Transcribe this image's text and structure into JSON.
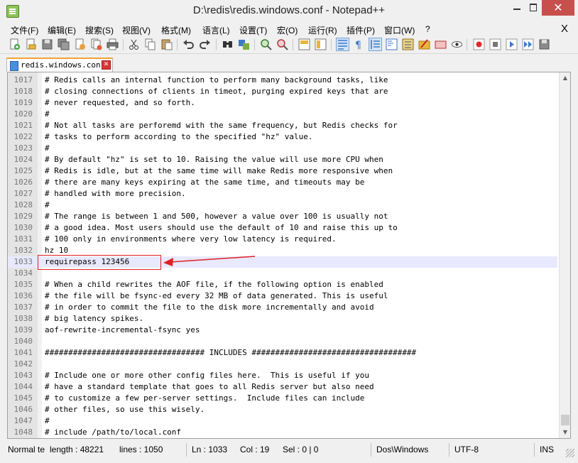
{
  "window": {
    "title": "D:\\redis\\redis.windows.conf - Notepad++",
    "close_label": "✕"
  },
  "menu": {
    "items": [
      "文件(F)",
      "编辑(E)",
      "搜索(S)",
      "视图(V)",
      "格式(M)",
      "语言(L)",
      "设置(T)",
      "宏(O)",
      "运行(R)",
      "插件(P)",
      "窗口(W)",
      "?"
    ],
    "close": "X"
  },
  "toolbar": {
    "icons": [
      "new-file-icon",
      "open-file-icon",
      "save-icon",
      "save-all-icon",
      "close-icon",
      "close-all-icon",
      "print-icon",
      "cut-icon",
      "copy-icon",
      "paste-icon",
      "undo-icon",
      "redo-icon",
      "find-icon",
      "replace-icon",
      "zoom-in-icon",
      "zoom-out-icon",
      "sync-vertical-icon",
      "sync-horizontal-icon",
      "word-wrap-icon",
      "show-all-chars-icon",
      "indent-guide-icon",
      "document-map-icon",
      "function-list-icon",
      "folder-workspace-icon",
      "monitoring-icon",
      "record-macro-icon",
      "stop-macro-icon",
      "play-macro-icon",
      "run-macro-multiple-icon",
      "save-macro-icon"
    ],
    "accent": "#3d79c6"
  },
  "tab": {
    "label": "redis.windows.conf",
    "close_label": "✕",
    "accent": "#f4a334"
  },
  "editor": {
    "lines": [
      {
        "n": "1017",
        "text": "# Redis calls an internal function to perform many background tasks, like"
      },
      {
        "n": "1018",
        "text": "# closing connections of clients in timeot, purging expired keys that are"
      },
      {
        "n": "1019",
        "text": "# never requested, and so forth."
      },
      {
        "n": "1020",
        "text": "#"
      },
      {
        "n": "1021",
        "text": "# Not all tasks are perforemd with the same frequency, but Redis checks for"
      },
      {
        "n": "1022",
        "text": "# tasks to perform according to the specified \"hz\" value."
      },
      {
        "n": "1023",
        "text": "#"
      },
      {
        "n": "1024",
        "text": "# By default \"hz\" is set to 10. Raising the value will use more CPU when"
      },
      {
        "n": "1025",
        "text": "# Redis is idle, but at the same time will make Redis more responsive when"
      },
      {
        "n": "1026",
        "text": "# there are many keys expiring at the same time, and timeouts may be"
      },
      {
        "n": "1027",
        "text": "# handled with more precision."
      },
      {
        "n": "1028",
        "text": "#"
      },
      {
        "n": "1029",
        "text": "# The range is between 1 and 500, however a value over 100 is usually not"
      },
      {
        "n": "1030",
        "text": "# a good idea. Most users should use the default of 10 and raise this up to"
      },
      {
        "n": "1031",
        "text": "# 100 only in environments where very low latency is required."
      },
      {
        "n": "1032",
        "text": "hz 10"
      },
      {
        "n": "1033",
        "text": "requirepass 123456"
      },
      {
        "n": "1034",
        "text": ""
      },
      {
        "n": "1035",
        "text": "# When a child rewrites the AOF file, if the following option is enabled"
      },
      {
        "n": "1036",
        "text": "# the file will be fsync-ed every 32 MB of data generated. This is useful"
      },
      {
        "n": "1037",
        "text": "# in order to commit the file to the disk more incrementally and avoid"
      },
      {
        "n": "1038",
        "text": "# big latency spikes."
      },
      {
        "n": "1039",
        "text": "aof-rewrite-incremental-fsync yes"
      },
      {
        "n": "1040",
        "text": ""
      },
      {
        "n": "1041",
        "text": "################################## INCLUDES ###################################"
      },
      {
        "n": "1042",
        "text": ""
      },
      {
        "n": "1043",
        "text": "# Include one or more other config files here.  This is useful if you"
      },
      {
        "n": "1044",
        "text": "# have a standard template that goes to all Redis server but also need"
      },
      {
        "n": "1045",
        "text": "# to customize a few per-server settings.  Include files can include"
      },
      {
        "n": "1046",
        "text": "# other files, so use this wisely."
      },
      {
        "n": "1047",
        "text": "#"
      },
      {
        "n": "1048",
        "text": "# include /path/to/local.conf"
      }
    ],
    "current_line_index": 16,
    "current_line_color": "#e8e8ff",
    "annotation_color": "#e02020"
  },
  "status": {
    "type": "Normal te",
    "length": "length : 48221",
    "lines": "lines : 1050",
    "ln": "Ln : 1033",
    "col": "Col : 19",
    "sel": "Sel : 0 | 0",
    "eol": "Dos\\Windows",
    "encoding": "UTF-8",
    "mode": "INS"
  }
}
